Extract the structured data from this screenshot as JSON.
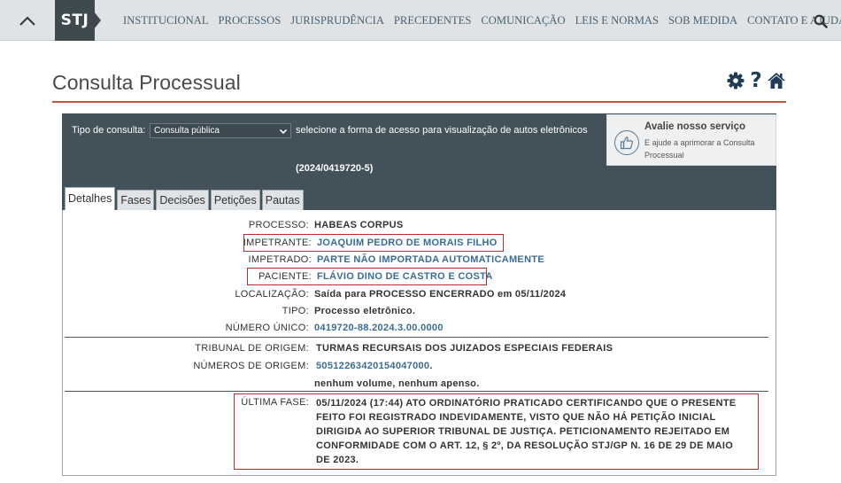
{
  "nav": {
    "logo": "STJ",
    "items": [
      "INSTITUCIONAL",
      "PROCESSOS",
      "JURISPRUDÊNCIA",
      "PRECEDENTES",
      "COMUNICAÇÃO",
      "LEIS E NORMAS",
      "SOB MEDIDA",
      "CONTATO E AJUDA"
    ],
    "icons": {
      "collapse": "chevron-up-icon",
      "search": "search-icon"
    }
  },
  "header": {
    "title": "Consulta Processual",
    "icons": [
      "gear-icon",
      "help-icon",
      "home-icon"
    ],
    "accent_color": "#b85a3c"
  },
  "panel": {
    "tipo_label": "Tipo de consulta:",
    "tipo_selected": "Consulta pública",
    "tipo_desc": "selecione a forma de acesso para visualização de autos eletrônicos",
    "process_id": "(2024/0419720-5)",
    "background_color": "#43525a"
  },
  "avalie": {
    "title": "Avalie nosso serviço",
    "subtitle": "E ajude a aprimorar a Consulta Processual",
    "icon": "thumbs-up-icon"
  },
  "tabs": [
    "Detalhes",
    "Fases",
    "Decisões",
    "Petições",
    "Pautas"
  ],
  "active_tab": "Detalhes",
  "details": {
    "processo": {
      "label": "PROCESSO:",
      "value": "HABEAS CORPUS"
    },
    "impetrante": {
      "label": "IMPETRANTE:",
      "value": "JOAQUIM PEDRO DE MORAIS FILHO"
    },
    "impetrado": {
      "label": "IMPETRADO:",
      "value": "PARTE NÃO IMPORTADA AUTOMATICAMENTE"
    },
    "paciente": {
      "label": "PACIENTE:",
      "value": "FLÁVIO DINO DE CASTRO E COSTA"
    },
    "localizacao": {
      "label": "LOCALIZAÇÃO:",
      "value": "Saída para PROCESSO ENCERRADO em 05/11/2024"
    },
    "tipo": {
      "label": "TIPO:",
      "value": "Processo eletrônico."
    },
    "numero_unico": {
      "label": "NÚMERO ÚNICO:",
      "value": "0419720-88.2024.3.00.0000"
    },
    "tribunal_origem": {
      "label": "TRIBUNAL DE ORIGEM:",
      "value": "TURMAS RECURSAIS DOS JUIZADOS ESPECIAIS FEDERAIS"
    },
    "numeros_origem": {
      "label": "NÚMEROS DE ORIGEM:",
      "value": "50512263420154047000",
      "suffix": "."
    },
    "volumes": "nenhum volume, nenhum apenso.",
    "ultima_fase": {
      "label": "ÚLTIMA FASE:",
      "value": "05/11/2024 (17:44) ATO ORDINATÓRIO PRATICADO CERTIFICANDO QUE O PRESENTE FEITO FOI REGISTRADO INDEVIDAMENTE, VISTO QUE NÃO HÁ PETIÇÃO INICIAL DIRIGIDA AO SUPERIOR TRIBUNAL DE JUSTIÇA. PETICIONAMENTO REJEITADO EM CONFORMIDADE COM O ART. 12, § 2º, DA RESOLUÇÃO STJ/GP N. 16 DE 29 DE MAIO DE 2023."
    },
    "highlight_color": "#c0282a",
    "link_color": "#3a6d96"
  }
}
